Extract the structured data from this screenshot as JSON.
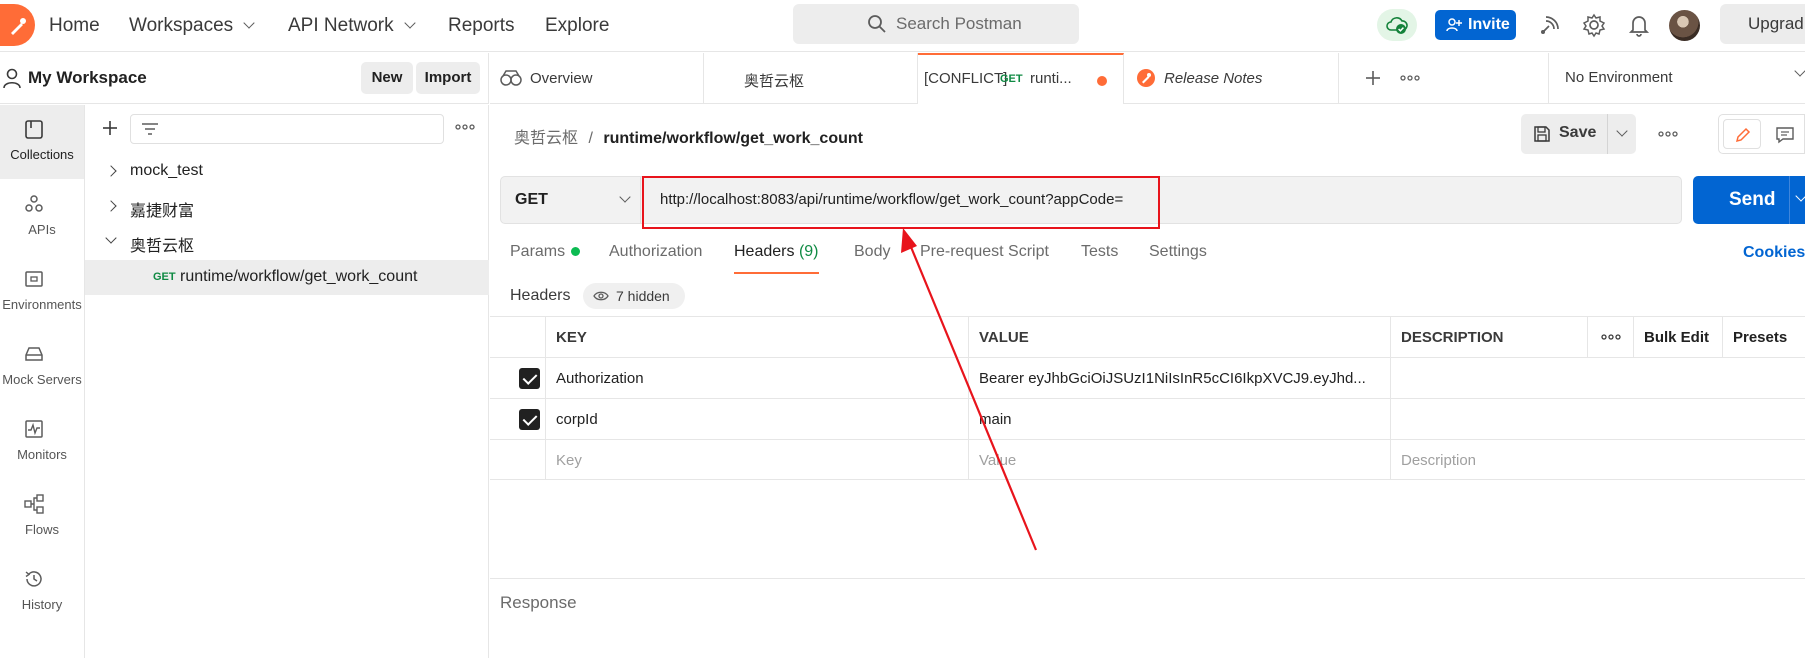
{
  "topbar": {
    "nav": [
      "Home",
      "Workspaces",
      "API Network",
      "Reports",
      "Explore"
    ],
    "search_placeholder": "Search Postman",
    "invite_label": "Invite",
    "upgrade_label": "Upgrad"
  },
  "workspace": {
    "name": "My Workspace",
    "new_label": "New",
    "import_label": "Import"
  },
  "rail": [
    {
      "label": "Collections",
      "icon": "collections-icon"
    },
    {
      "label": "APIs",
      "icon": "apis-icon"
    },
    {
      "label": "Environments",
      "icon": "environments-icon"
    },
    {
      "label": "Mock Servers",
      "icon": "mock-servers-icon"
    },
    {
      "label": "Monitors",
      "icon": "monitors-icon"
    },
    {
      "label": "Flows",
      "icon": "flows-icon"
    },
    {
      "label": "History",
      "icon": "history-icon"
    }
  ],
  "tree": {
    "items": [
      {
        "label": "mock_test",
        "expanded": false
      },
      {
        "label": "嘉捷财富",
        "expanded": false
      },
      {
        "label": "奥哲云枢",
        "expanded": true
      }
    ],
    "request": {
      "method": "GET",
      "label": "runtime/workflow/get_work_count"
    }
  },
  "tabs": [
    {
      "label": "Overview"
    },
    {
      "label": "奥哲云枢"
    },
    {
      "prefix": "[CONFLICT]",
      "method": "GET",
      "label": "runti..."
    },
    {
      "label": "Release Notes"
    }
  ],
  "environment": "No Environment",
  "request": {
    "breadcrumb_parent": "奥哲云枢",
    "breadcrumb_sep": "/",
    "breadcrumb_current": "runtime/workflow/get_work_count",
    "save_label": "Save",
    "method": "GET",
    "url": "http://localhost:8083/api/runtime/workflow/get_work_count?appCode=",
    "send_label": "Send",
    "tabs": {
      "params": "Params",
      "authorization": "Authorization",
      "headers": "Headers",
      "headers_count": "(9)",
      "body": "Body",
      "prerequest": "Pre-request Script",
      "tests": "Tests",
      "settings": "Settings"
    },
    "cookies_label": "Cookies"
  },
  "headers": {
    "label": "Headers",
    "hidden": "7 hidden",
    "columns": {
      "key": "KEY",
      "value": "VALUE",
      "description": "DESCRIPTION",
      "bulk_edit": "Bulk Edit",
      "presets": "Presets"
    },
    "rows": [
      {
        "key": "Authorization",
        "value": "Bearer eyJhbGciOiJSUzI1NiIsInR5cCI6IkpXVCJ9.eyJhd...",
        "checked": true
      },
      {
        "key": "corpId",
        "value": "main",
        "checked": true
      }
    ],
    "placeholder": {
      "key": "Key",
      "value": "Value",
      "description": "Description"
    }
  },
  "response_label": "Response",
  "colors": {
    "accent": "#ff6c37",
    "primary": "#0265d2",
    "annotation": "#e8141c"
  }
}
